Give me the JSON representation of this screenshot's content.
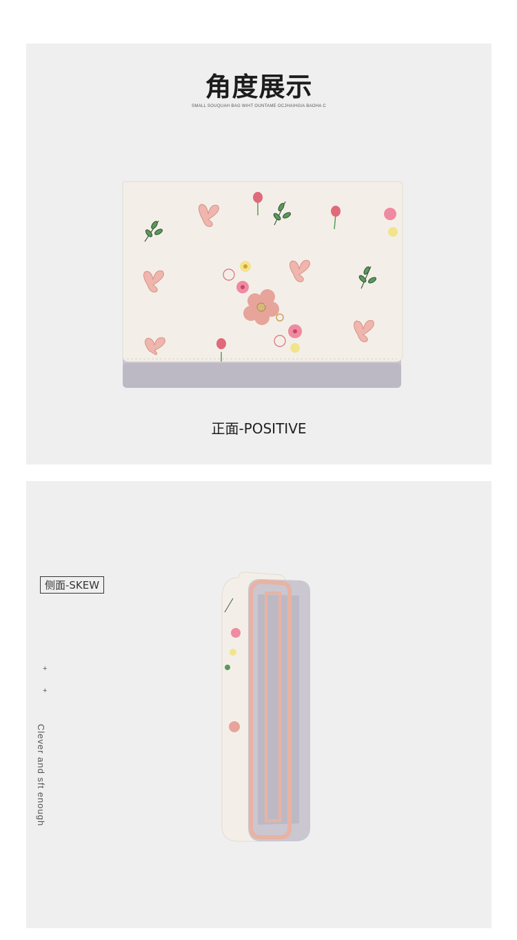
{
  "top_section": {
    "title": "角度展示",
    "subtitle": "SMALL SOUQUAH BAG WIHT OUNTAME OCJHAIHGIA BAOHA C",
    "caption": "正面-POSITIVE"
  },
  "bottom_section": {
    "label": "侧面-SKEW",
    "plus_1": "+",
    "plus_2": "+",
    "vertical_text": "Clever and sft enough"
  },
  "colors": {
    "panel_bg": "#efefef",
    "wallet_body": "#f3efe8",
    "wallet_base": "#c9c5cf",
    "pink_accent": "#e99aa0",
    "leaf_green": "#5a9a5a"
  }
}
